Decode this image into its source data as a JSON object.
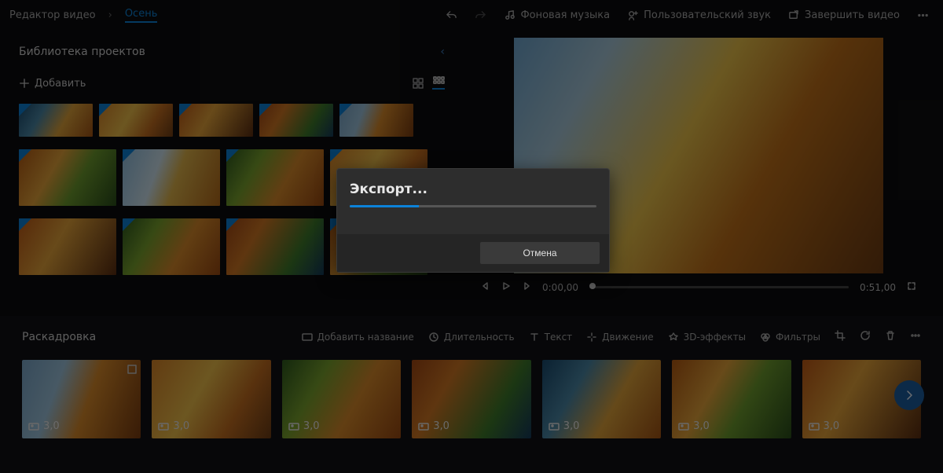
{
  "header": {
    "app_name": "Редактор видео",
    "project_name": "Осень",
    "buttons": {
      "bg_music": "Фоновая музыка",
      "custom_audio": "Пользовательский звук",
      "finish": "Завершить видео"
    }
  },
  "library": {
    "title": "Библиотека проектов",
    "add_label": "Добавить"
  },
  "preview": {
    "current_time": "0:00,00",
    "total_time": "0:51,00"
  },
  "storyboard": {
    "title": "Раскадровка",
    "tools": {
      "add_title": "Добавить название",
      "duration": "Длительность",
      "text": "Текст",
      "motion": "Движение",
      "effects": "3D-эффекты",
      "filters": "Фильтры"
    },
    "clips": [
      {
        "duration": "3,0"
      },
      {
        "duration": "3,0"
      },
      {
        "duration": "3,0"
      },
      {
        "duration": "3,0"
      },
      {
        "duration": "3,0"
      },
      {
        "duration": "3,0"
      },
      {
        "duration": "3,0"
      }
    ]
  },
  "dialog": {
    "title": "Экспорт...",
    "cancel": "Отмена"
  }
}
